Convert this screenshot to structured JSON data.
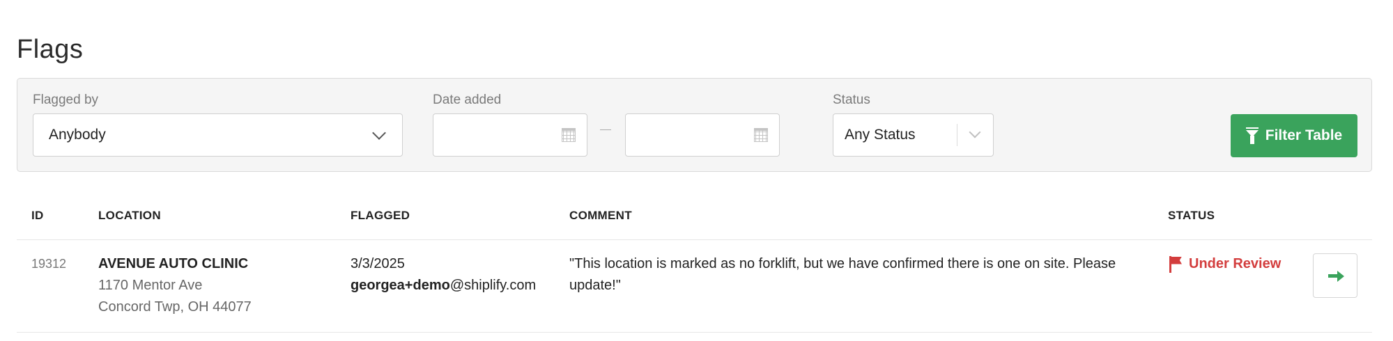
{
  "page": {
    "title": "Flags"
  },
  "filters": {
    "flagged_by": {
      "label": "Flagged by",
      "value": "Anybody"
    },
    "date_added": {
      "label": "Date added",
      "from_value": "",
      "to_value": "",
      "separator": "–"
    },
    "status": {
      "label": "Status",
      "value": "Any Status"
    },
    "filter_button": {
      "label": "Filter Table"
    }
  },
  "table": {
    "columns": [
      "ID",
      "LOCATION",
      "FLAGGED",
      "COMMENT",
      "STATUS"
    ],
    "rows": [
      {
        "id": "19312",
        "location_name": "AVENUE AUTO CLINIC",
        "address_line1": "1170 Mentor Ave",
        "address_line2": "Concord Twp, OH 44077",
        "flagged_date": "3/3/2025",
        "flagged_by_user": "georgea+demo",
        "flagged_by_domain": "@shiplify.com",
        "comment": "\"This location is marked as no forklift, but we have confirmed there is one on site. Please update!\"",
        "status": "Under Review"
      }
    ]
  },
  "colors": {
    "accent_green": "#3aa35c",
    "status_red": "#d33d3d"
  },
  "icons": [
    "chevron-down-icon",
    "calendar-icon",
    "filter-icon",
    "flag-icon",
    "arrow-right-icon"
  ]
}
